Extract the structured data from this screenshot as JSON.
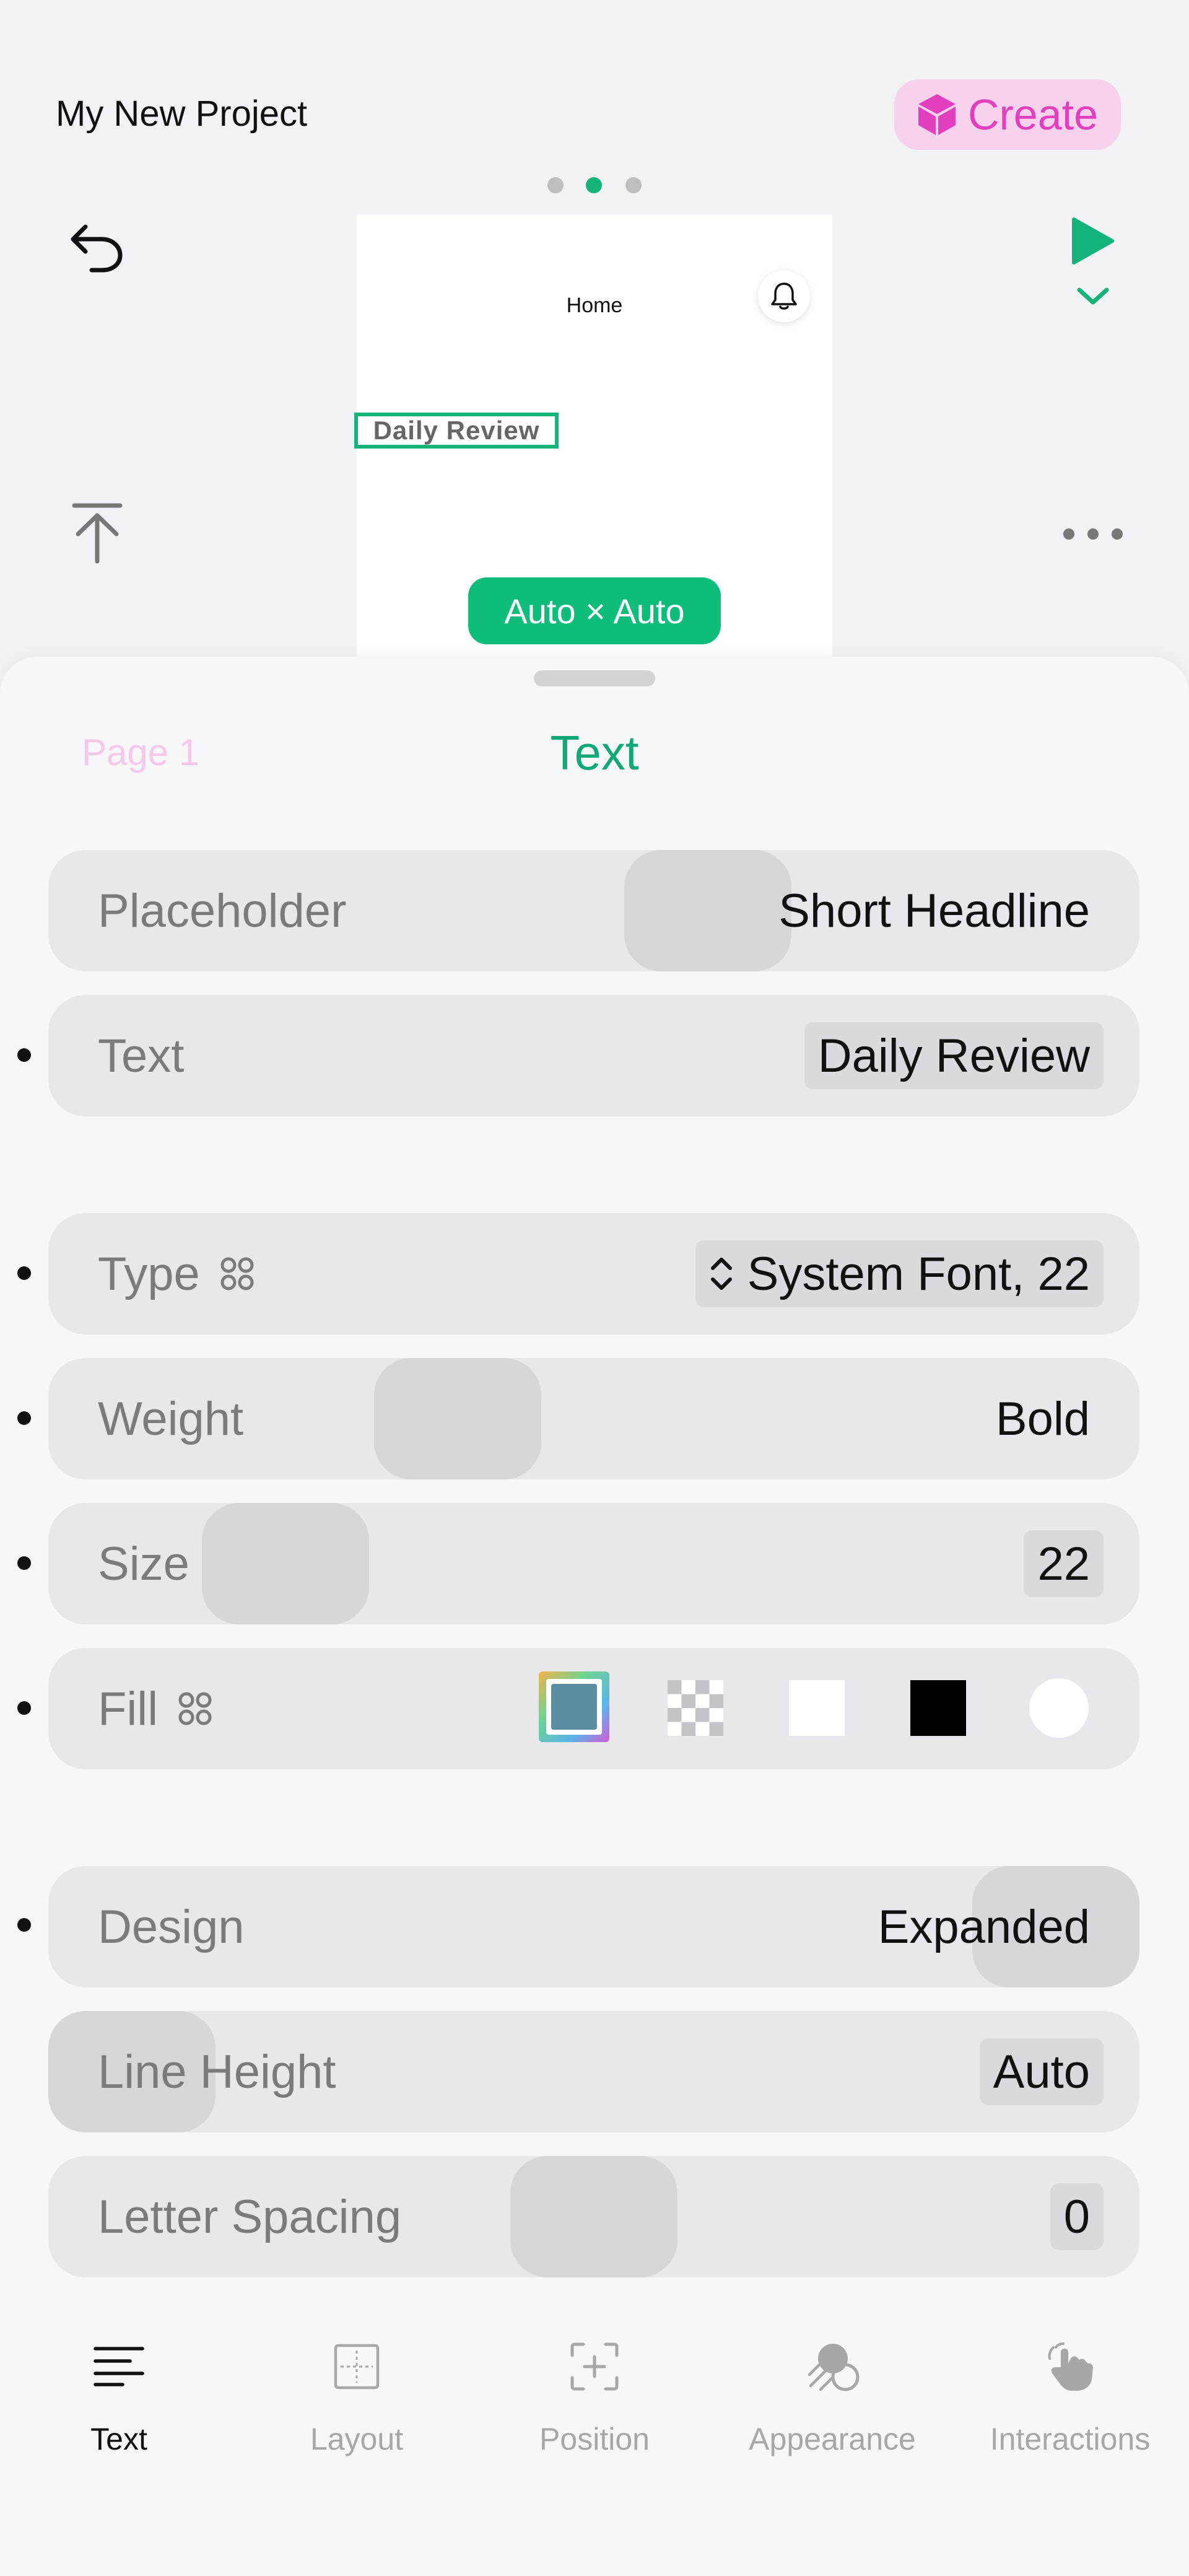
{
  "header": {
    "project_title": "My New Project",
    "create_label": "Create",
    "page_dots": 3,
    "active_page_dot": 1
  },
  "preview": {
    "nav_title": "Home",
    "selected_text": "Daily Review",
    "size_badge": "Auto × Auto"
  },
  "sheet": {
    "back_label": "Page 1",
    "title": "Text",
    "rows": {
      "placeholder": {
        "label": "Placeholder",
        "value": "Short Headline"
      },
      "text": {
        "label": "Text",
        "value": "Daily Review"
      },
      "type": {
        "label": "Type",
        "value": "System Font, 22"
      },
      "weight": {
        "label": "Weight",
        "value": "Bold"
      },
      "size": {
        "label": "Size",
        "value": "22"
      },
      "fill": {
        "label": "Fill"
      },
      "design": {
        "label": "Design",
        "value": "Expanded"
      },
      "line_height": {
        "label": "Line Height",
        "value": "Auto"
      },
      "letter_spacing": {
        "label": "Letter Spacing",
        "value": "0"
      }
    },
    "fill_swatches": [
      {
        "name": "custom-color",
        "color": "#5a8ea2"
      },
      {
        "name": "transparent",
        "color": "checker"
      },
      {
        "name": "white",
        "color": "#ffffff"
      },
      {
        "name": "black",
        "color": "#000000"
      },
      {
        "name": "circle-white",
        "color": "#ffffff"
      }
    ]
  },
  "tabs": [
    {
      "label": "Text",
      "icon": "text-align-icon",
      "active": true
    },
    {
      "label": "Layout",
      "icon": "layout-icon",
      "active": false
    },
    {
      "label": "Position",
      "icon": "position-icon",
      "active": false
    },
    {
      "label": "Appearance",
      "icon": "appearance-icon",
      "active": false
    },
    {
      "label": "Interactions",
      "icon": "hand-tap-icon",
      "active": false
    }
  ],
  "colors": {
    "accent": "#14b37a",
    "create_text": "#e23fbf",
    "create_bg": "#f6d2ec"
  }
}
